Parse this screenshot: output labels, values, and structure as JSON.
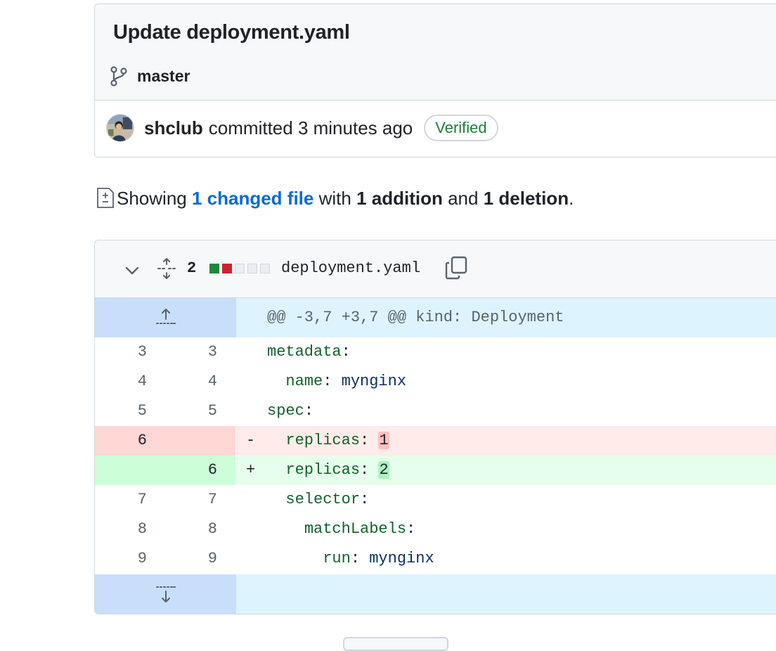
{
  "commit": {
    "title": "Update deployment.yaml",
    "branch": "master",
    "author": "shclub",
    "committed_text": "committed 3 minutes ago",
    "verified_label": "Verified"
  },
  "summary": {
    "prefix": "Showing",
    "changed_link": "1 changed file",
    "with": "with",
    "additions": "1 addition",
    "and": "and",
    "deletions": "1 deletion",
    "period": "."
  },
  "file": {
    "change_count": "2",
    "name": "deployment.yaml",
    "diffstat": [
      "add",
      "del",
      "neutral",
      "neutral",
      "neutral"
    ]
  },
  "diff": {
    "hunk_header": "@@ -3,7 +3,7 @@ kind: Deployment",
    "lines": [
      {
        "type": "ctx",
        "old": "3",
        "new": "3",
        "marker": " ",
        "indent": "",
        "key": "metadata",
        "sep": ":",
        "value": ""
      },
      {
        "type": "ctx",
        "old": "4",
        "new": "4",
        "marker": " ",
        "indent": "  ",
        "key": "name",
        "sep": ": ",
        "value": "mynginx"
      },
      {
        "type": "ctx",
        "old": "5",
        "new": "5",
        "marker": " ",
        "indent": "",
        "key": "spec",
        "sep": ":",
        "value": ""
      },
      {
        "type": "del",
        "old": "6",
        "new": "",
        "marker": "-",
        "indent": "  ",
        "key": "replicas",
        "sep": ": ",
        "value": "1"
      },
      {
        "type": "add",
        "old": "",
        "new": "6",
        "marker": "+",
        "indent": "  ",
        "key": "replicas",
        "sep": ": ",
        "value": "2"
      },
      {
        "type": "ctx",
        "old": "7",
        "new": "7",
        "marker": " ",
        "indent": "  ",
        "key": "selector",
        "sep": ":",
        "value": ""
      },
      {
        "type": "ctx",
        "old": "8",
        "new": "8",
        "marker": " ",
        "indent": "    ",
        "key": "matchLabels",
        "sep": ":",
        "value": ""
      },
      {
        "type": "ctx",
        "old": "9",
        "new": "9",
        "marker": " ",
        "indent": "      ",
        "key": "run",
        "sep": ": ",
        "value": "mynginx"
      }
    ]
  },
  "colors": {
    "addition": "#1f883d",
    "deletion": "#cf222e",
    "link": "#0969da",
    "verified": "#1a7f37"
  },
  "icons": {
    "branch": "git-branch-icon",
    "diff_file": "file-diff-icon",
    "chevron": "chevron-down-icon",
    "expand": "unfold-icon",
    "copy": "copy-icon",
    "expand_up": "expand-up-icon",
    "expand_down": "expand-down-icon"
  }
}
